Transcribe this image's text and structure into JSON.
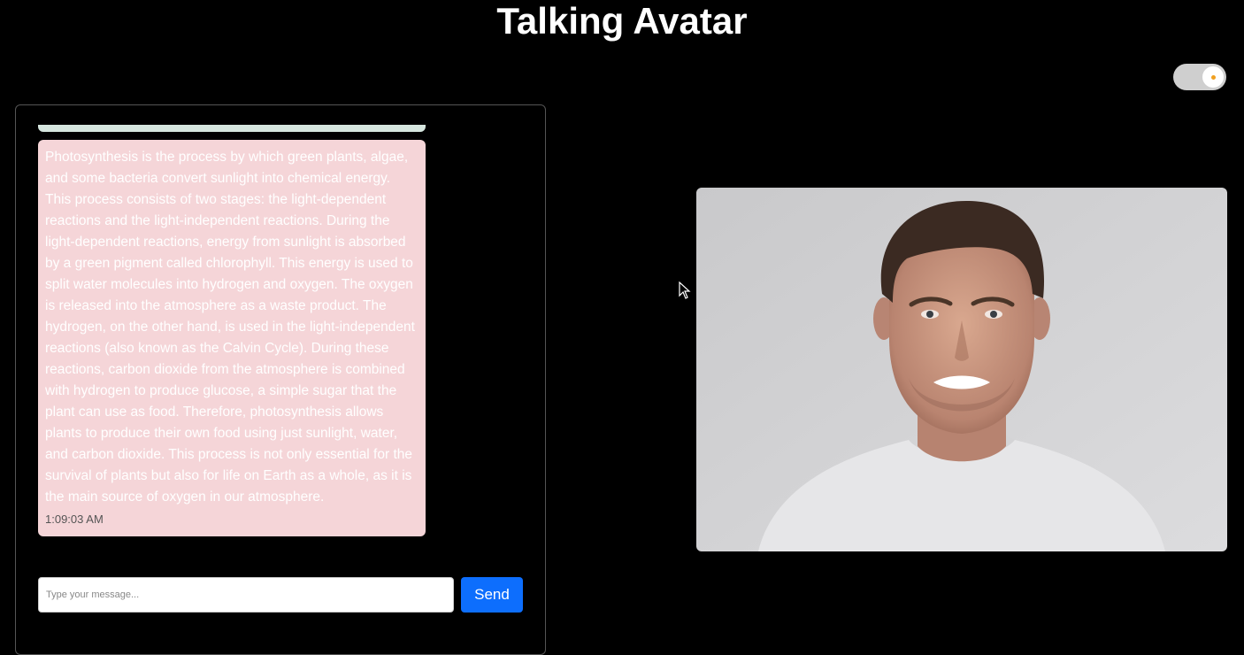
{
  "header": {
    "title": "Talking Avatar"
  },
  "theme_toggle": {
    "state": "on",
    "track_color": "#cfcfcf",
    "dot_color": "#f0a020"
  },
  "chat": {
    "messages": [
      {
        "text": "Photosynthesis is the process by which green plants, algae, and some bacteria convert sunlight into chemical energy. This process consists of two stages: the light-dependent reactions and the light-independent reactions. During the light-dependent reactions, energy from sunlight is absorbed by a green pigment called chlorophyll. This energy is used to split water molecules into hydrogen and oxygen. The oxygen is released into the atmosphere as a waste product. The hydrogen, on the other hand, is used in the light-independent reactions (also known as the Calvin Cycle). During these reactions, carbon dioxide from the atmosphere is combined with hydrogen to produce glucose, a simple sugar that the plant can use as food. Therefore, photosynthesis allows plants to produce their own food using just sunlight, water, and carbon dioxide. This process is not only essential for the survival of plants but also for life on Earth as a whole, as it is the main source of oxygen in our atmosphere.",
        "time": "1:09:03 AM",
        "bubble_color": "#f5d5d8"
      }
    ],
    "input": {
      "placeholder": "Type your message...",
      "value": ""
    },
    "send_label": "Send",
    "send_color": "#0d6efd"
  },
  "avatar": {
    "icon": "talking-avatar-face"
  }
}
